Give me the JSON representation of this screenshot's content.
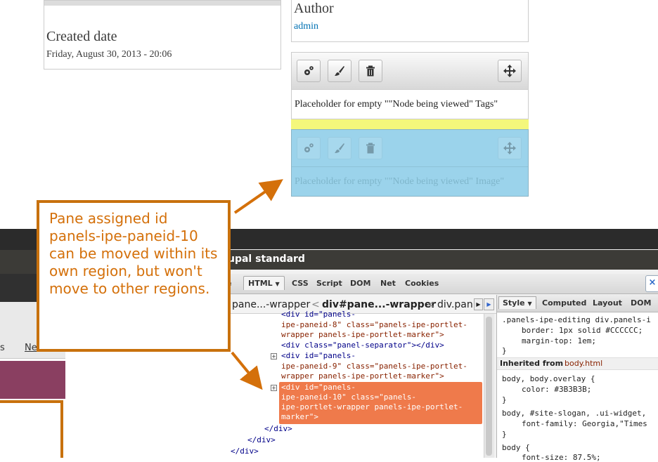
{
  "page": {
    "created_date": {
      "heading": "Created date",
      "value": "Friday, August 30, 2013 - 20:06"
    },
    "author": {
      "heading": "Author",
      "link": "admin"
    },
    "pane_tags": {
      "placeholder": "Placeholder for empty \"\"Node being viewed\" Tags\""
    },
    "pane_image": {
      "placeholder": "Placeholder for empty \"\"Node being viewed\" Image\""
    }
  },
  "icons": {
    "settings": "gears-icon",
    "style": "paintbrush-icon",
    "delete": "trash-icon",
    "move": "move-arrows-icon"
  },
  "colors": {
    "callout": "#d4700a",
    "selected_row": "#ef7a4b",
    "pane_highlight": "#9bd3eb",
    "drop_target": "#f4f77b"
  },
  "callout": {
    "text": "Pane assigned id panels-ipe-paneid-10 can be moved within its own region, but won't move to other regions."
  },
  "browser": {
    "left_tab_fragment": "s",
    "left_link_fragment": "Ne"
  },
  "firebug": {
    "window_title": "upal standard",
    "tabs": [
      "e",
      "HTML",
      "CSS",
      "Script",
      "DOM",
      "Net",
      "Cookies"
    ],
    "breadcrumb": [
      "pane...-wrapper",
      "<",
      "div#pane...-wrapper",
      "<",
      "div.pan"
    ],
    "html_lines": [
      "<div id=\"panels-",
      "ipe-paneid-8\" class=\"panels-ipe-portlet-",
      "wrapper panels-ipe-portlet-marker\">",
      "<div class=\"panel-separator\"></div>",
      "<div id=\"panels-",
      "ipe-paneid-9\" class=\"panels-ipe-portlet-",
      "wrapper panels-ipe-portlet-marker\">",
      "<div id=\"panels-",
      "ipe-paneid-10\" class=\"panels-",
      "ipe-portlet-wrapper panels-ipe-portlet-",
      "marker\">",
      "</div>",
      "</div>",
      "</div>"
    ],
    "side_tabs": [
      "Style",
      "Computed",
      "Layout",
      "DOM"
    ],
    "css": {
      "selector1": ".panels-ipe-editing div.panels-i",
      "border": "border: 1px solid #CCCCCC;",
      "margin": "margin-top: 1em;",
      "close1": "}",
      "inherited_label": "Inherited from",
      "inherited_element": "body.html",
      "selector2": "body, body.overlay {",
      "color": "color: #3B3B3B;",
      "close2": "}",
      "selector3": "body, #site-slogan, .ui-widget,",
      "font": "font-family: Georgia,\"Times",
      "close3": "}",
      "selector4": "body {",
      "font_size": "font-size: 87.5%;"
    }
  }
}
